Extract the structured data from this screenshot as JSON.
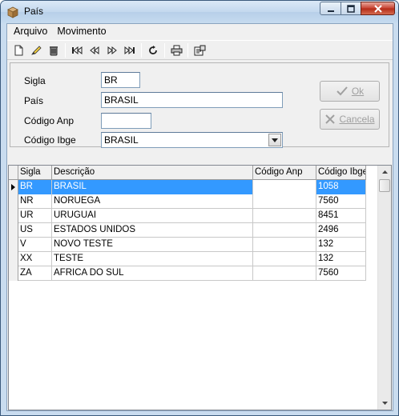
{
  "window": {
    "title": "País"
  },
  "menu": {
    "items": [
      "Arquivo",
      "Movimento"
    ]
  },
  "toolbar": {
    "icons": [
      "new-icon",
      "edit-icon",
      "delete-icon",
      "first-icon",
      "prior-icon",
      "next-icon",
      "last-icon",
      "refresh-icon",
      "print-icon",
      "report-icon"
    ]
  },
  "form": {
    "sigla_label": "Sigla",
    "sigla_value": "BR",
    "pais_label": "País",
    "pais_value": "BRASIL",
    "anp_label": "Código Anp",
    "anp_value": "",
    "ibge_label": "Código Ibge",
    "ibge_value": "BRASIL",
    "ok_label": "Ok",
    "cancel_label": "Cancela"
  },
  "grid": {
    "columns": [
      "Sigla",
      "Descrição",
      "Código Anp",
      "Código Ibge"
    ],
    "rows": [
      {
        "sigla": "BR",
        "descricao": "BRASIL",
        "anp": "",
        "ibge": "1058"
      },
      {
        "sigla": "NR",
        "descricao": "NORUEGA",
        "anp": "",
        "ibge": "7560"
      },
      {
        "sigla": "UR",
        "descricao": "URUGUAI",
        "anp": "",
        "ibge": "8451"
      },
      {
        "sigla": "US",
        "descricao": "ESTADOS UNIDOS",
        "anp": "",
        "ibge": "2496"
      },
      {
        "sigla": "V",
        "descricao": "NOVO TESTE",
        "anp": "",
        "ibge": "132"
      },
      {
        "sigla": "XX",
        "descricao": "TESTE",
        "anp": "",
        "ibge": "132"
      },
      {
        "sigla": "ZA",
        "descricao": "AFRICA DO SUL",
        "anp": "",
        "ibge": "7560"
      }
    ],
    "selected_row": 0
  },
  "colors": {
    "selection": "#3399ff",
    "window_frame": "#c9dcef"
  }
}
